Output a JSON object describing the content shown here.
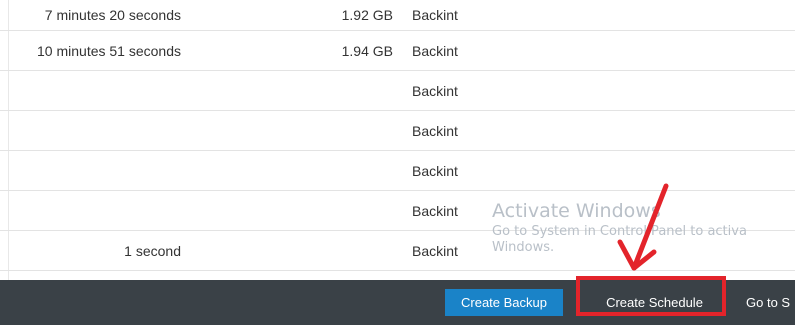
{
  "table": {
    "rows": [
      {
        "duration": "7 minutes 20 seconds",
        "size": "1.92 GB",
        "destination": "Backint"
      },
      {
        "duration": "10 minutes 51 seconds",
        "size": "1.94 GB",
        "destination": "Backint"
      },
      {
        "duration": "",
        "size": "",
        "destination": "Backint"
      },
      {
        "duration": "",
        "size": "",
        "destination": "Backint"
      },
      {
        "duration": "",
        "size": "",
        "destination": "Backint"
      },
      {
        "duration": "",
        "size": "",
        "destination": "Backint"
      },
      {
        "duration": "1 second",
        "size": "",
        "destination": "Backint"
      }
    ]
  },
  "watermark": {
    "title": "Activate Windows",
    "line1": "Go to System in Control Panel to activa",
    "line2": "Windows."
  },
  "footer": {
    "create_backup_label": "Create Backup",
    "create_schedule_label": "Create Schedule",
    "goto_label": "Go to S"
  },
  "colors": {
    "footer_bg": "#3a4147",
    "primary_button": "#1a83c8",
    "annotation_red": "#e3242b"
  }
}
